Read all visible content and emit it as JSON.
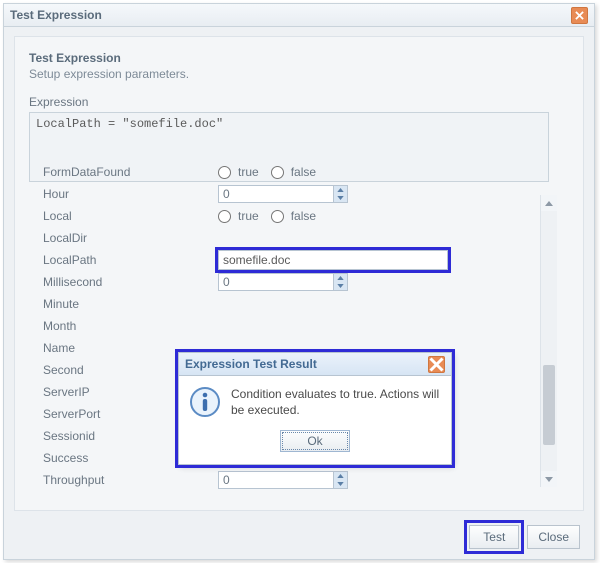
{
  "window": {
    "title": "Test Expression",
    "header_title": "Test Expression",
    "header_sub": "Setup expression parameters.",
    "expression_label": "Expression",
    "expression_value": "LocalPath = \"somefile.doc\""
  },
  "radio_labels": {
    "true": "true",
    "false": "false"
  },
  "params": [
    {
      "name": "FormDataFound",
      "type": "bool"
    },
    {
      "name": "Hour",
      "type": "num",
      "value": "0"
    },
    {
      "name": "Local",
      "type": "bool"
    },
    {
      "name": "LocalDir",
      "type": "blank"
    },
    {
      "name": "LocalPath",
      "type": "text",
      "value": "somefile.doc",
      "highlight": true
    },
    {
      "name": "Millisecond",
      "type": "num",
      "value": "0"
    },
    {
      "name": "Minute",
      "type": "blank"
    },
    {
      "name": "Month",
      "type": "blank"
    },
    {
      "name": "Name",
      "type": "blank"
    },
    {
      "name": "Second",
      "type": "blank"
    },
    {
      "name": "ServerIP",
      "type": "blank"
    },
    {
      "name": "ServerPort",
      "type": "blank"
    },
    {
      "name": "Sessionid",
      "type": "blank"
    },
    {
      "name": "Success",
      "type": "bool"
    },
    {
      "name": "Throughput",
      "type": "num",
      "value": "0"
    }
  ],
  "footer": {
    "test": "Test",
    "close": "Close"
  },
  "modal": {
    "title": "Expression Test Result",
    "message": "Condition evaluates to true. Actions will be executed.",
    "ok": "Ok"
  }
}
